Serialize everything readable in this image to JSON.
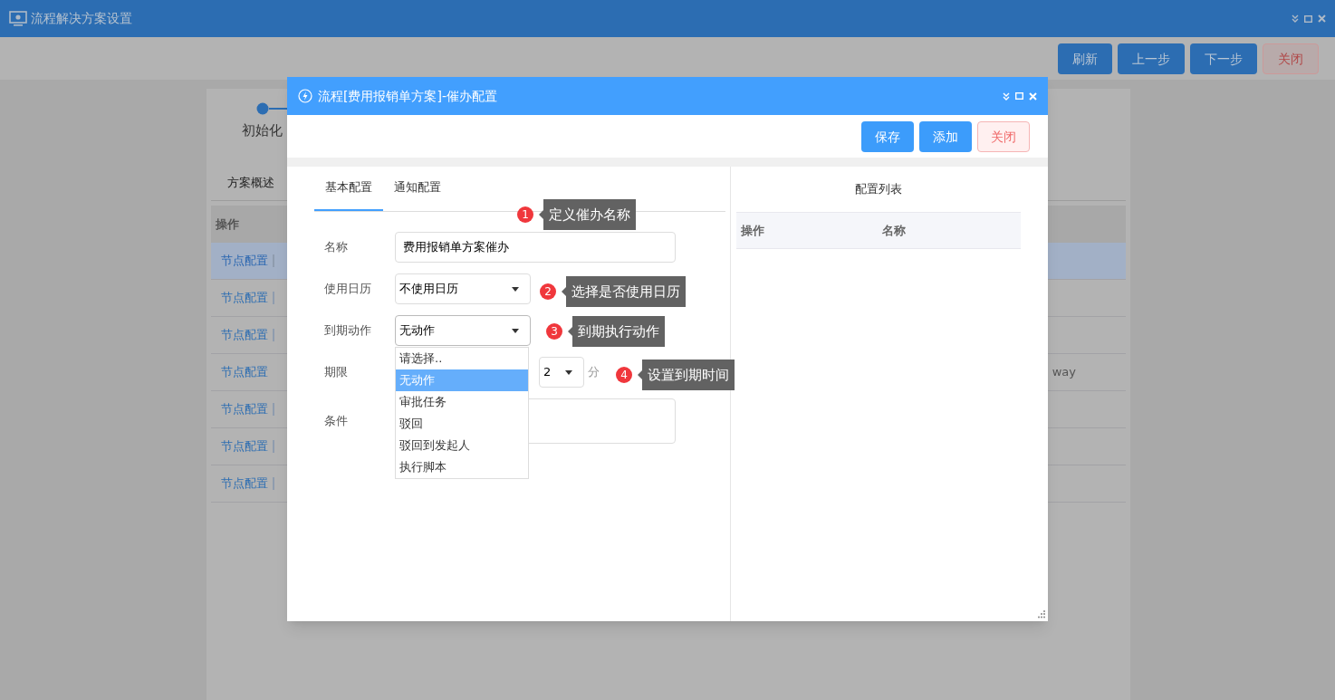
{
  "window": {
    "title": "流程解决方案设置"
  },
  "toolbar": {
    "buttons": [
      {
        "label": "刷新",
        "kind": "primary"
      },
      {
        "label": "上一步",
        "kind": "primary"
      },
      {
        "label": "下一步",
        "kind": "primary"
      },
      {
        "label": "关闭",
        "kind": "danger"
      }
    ]
  },
  "steps": [
    {
      "label": "初始化",
      "selected": true
    }
  ],
  "tabs": [
    {
      "label": "方案概述",
      "selected": true
    }
  ],
  "table": {
    "columns": [
      "操作"
    ],
    "rows": [
      {
        "action": "节点配置",
        "more": true,
        "selected": true
      },
      {
        "action": "节点配置",
        "more": true,
        "selected": false
      },
      {
        "action": "节点配置",
        "more": true,
        "selected": false
      },
      {
        "action": "节点配置",
        "more": false,
        "selected": false,
        "column_3": "way"
      },
      {
        "action": "节点配置",
        "more": true,
        "selected": false
      },
      {
        "action": "节点配置",
        "more": true,
        "selected": false
      },
      {
        "action": "节点配置",
        "more": true,
        "selected": false
      }
    ]
  },
  "dialog": {
    "title": "流程[费用报销单方案]-催办配置",
    "buttons": [
      {
        "label": "保存",
        "kind": "primary"
      },
      {
        "label": "添加",
        "kind": "primary"
      },
      {
        "label": "关闭",
        "kind": "danger"
      }
    ],
    "tabs": [
      {
        "label": "基本配置",
        "selected": true
      },
      {
        "label": "通知配置",
        "selected": false
      }
    ],
    "form": [
      {
        "label": "名称",
        "kind": "text",
        "value": "费用报销单方案催办"
      },
      {
        "label": "使用日历",
        "kind": "select",
        "value": "不使用日历",
        "expanded": false
      },
      {
        "label": "到期动作",
        "kind": "select",
        "value": "无动作",
        "expanded": true,
        "options": [
          {
            "label": "请选择..",
            "selected": false
          },
          {
            "label": "无动作",
            "selected": true
          },
          {
            "label": "审批任务",
            "selected": false
          },
          {
            "label": "驳回",
            "selected": false
          },
          {
            "label": "驳回到发起人",
            "selected": false
          },
          {
            "label": "执行脚本",
            "selected": false
          }
        ]
      },
      {
        "label": "期限",
        "kind": "deadline",
        "value": "2",
        "unit": "分"
      },
      {
        "label": "条件",
        "kind": "textarea"
      }
    ],
    "annotations": [
      {
        "number": "1",
        "text": "定义催办名称"
      },
      {
        "number": "2",
        "text": "选择是否使用日历"
      },
      {
        "number": "3",
        "text": "到期执行动作"
      },
      {
        "number": "4",
        "text": "设置到期时间"
      }
    ],
    "list_panel": {
      "title": "配置列表",
      "columns": [
        "操作",
        "名称"
      ]
    }
  }
}
